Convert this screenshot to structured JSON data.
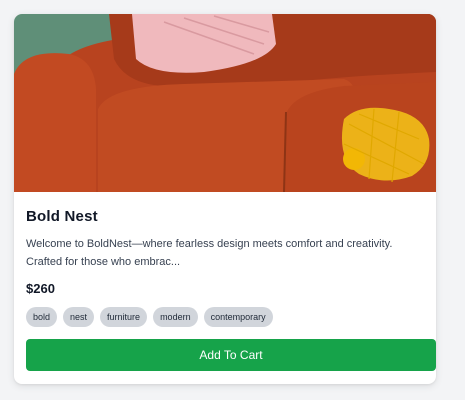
{
  "product": {
    "title": "Bold Nest",
    "description": "Welcome to BoldNest—where fearless design meets comfort and creativity. Crafted for those who embrac...",
    "price": "$260",
    "tags": [
      "bold",
      "nest",
      "furniture",
      "modern",
      "contemporary"
    ],
    "cta_label": "Add To Cart"
  },
  "colors": {
    "cta_background": "#16a34a",
    "tag_background": "#d1d5db",
    "sofa": "#b8431f",
    "pillow": "#f0b9bd",
    "accent_fruit": "#f5c518"
  }
}
